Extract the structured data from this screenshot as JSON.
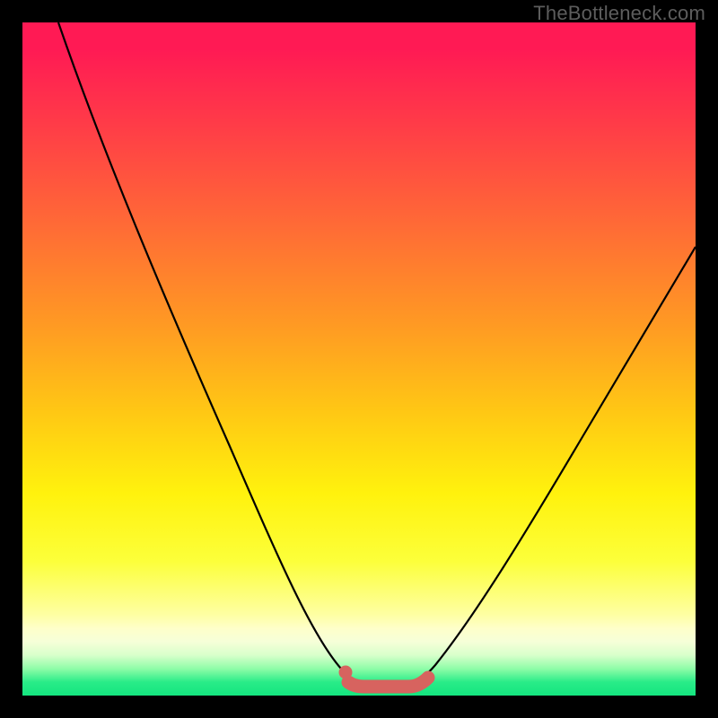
{
  "watermark": "TheBottleneck.com",
  "colors": {
    "curve": "#000000",
    "marker": "#d7635f",
    "frame": "#000000"
  },
  "chart_data": {
    "type": "line",
    "title": "",
    "xlabel": "",
    "ylabel": "",
    "xlim": [
      0,
      100
    ],
    "ylim": [
      0,
      100
    ],
    "grid": false,
    "series": [
      {
        "name": "bottleneck-curve",
        "x": [
          0,
          5,
          10,
          15,
          20,
          25,
          30,
          35,
          40,
          45,
          48,
          50,
          53,
          56,
          58,
          60,
          65,
          70,
          75,
          80,
          85,
          90,
          95,
          100
        ],
        "values": [
          100,
          90,
          80,
          70,
          60,
          49,
          39,
          29,
          19,
          10,
          4,
          2,
          1,
          1,
          2,
          3,
          8,
          15,
          23,
          32,
          41,
          50,
          60,
          70
        ]
      }
    ],
    "annotations": [
      {
        "name": "sweet-spot-marker",
        "x_range": [
          48,
          58
        ],
        "y": 2
      }
    ]
  }
}
